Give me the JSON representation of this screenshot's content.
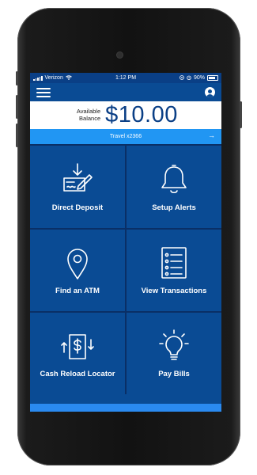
{
  "status_bar": {
    "carrier": "Verizon",
    "time": "1:12 PM",
    "battery": "90%"
  },
  "header": {
    "menu_icon": "hamburger-menu-icon",
    "profile_icon": "user-profile-icon"
  },
  "balance": {
    "label_line1": "Available",
    "label_line2": "Balance",
    "amount": "$10.00"
  },
  "account": {
    "name": "Travel x2366",
    "arrow": "→"
  },
  "tiles": [
    {
      "label": "Direct Deposit",
      "icon": "direct-deposit-icon"
    },
    {
      "label": "Setup Alerts",
      "icon": "bell-icon"
    },
    {
      "label": "Find an ATM",
      "icon": "location-pin-icon"
    },
    {
      "label": "View Transactions",
      "icon": "transactions-list-icon"
    },
    {
      "label": "Cash Reload Locator",
      "icon": "cash-reload-icon"
    },
    {
      "label": "Pay Bills",
      "icon": "lightbulb-icon"
    }
  ],
  "colors": {
    "primary": "#0a4b94",
    "accent": "#2196f3",
    "amount_text": "#0a3f86"
  }
}
